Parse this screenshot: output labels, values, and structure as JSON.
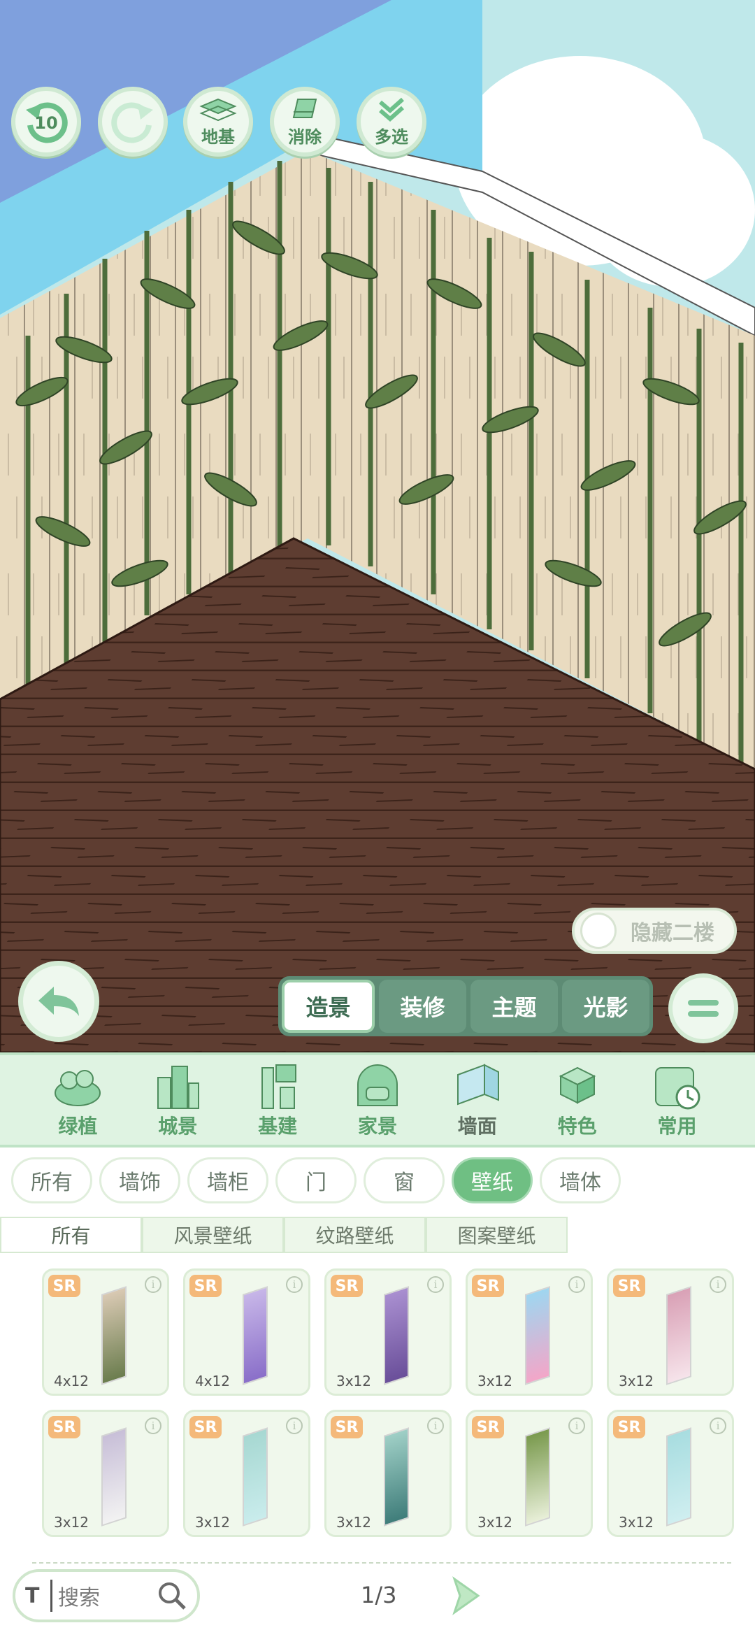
{
  "toolbar": {
    "undo_count": "10",
    "tools": [
      {
        "icon": "undo-icon",
        "label": "10"
      },
      {
        "icon": "redo-icon",
        "label": ""
      },
      {
        "icon": "foundation-icon",
        "label": "地基"
      },
      {
        "icon": "eraser-icon",
        "label": "消除"
      },
      {
        "icon": "multiselect-icon",
        "label": "多选"
      }
    ]
  },
  "hide_second_floor": {
    "label": "隐藏二楼",
    "on": false
  },
  "modes": [
    "造景",
    "装修",
    "主题",
    "光影"
  ],
  "active_mode": "造景",
  "categories": [
    {
      "label": "绿植",
      "icon": "plant-icon"
    },
    {
      "label": "城景",
      "icon": "city-icon"
    },
    {
      "label": "基建",
      "icon": "construction-icon"
    },
    {
      "label": "家景",
      "icon": "home-icon"
    },
    {
      "label": "墙面",
      "icon": "wall-icon"
    },
    {
      "label": "特色",
      "icon": "special-icon"
    },
    {
      "label": "常用",
      "icon": "calendar-icon"
    }
  ],
  "active_category": "墙面",
  "subtabs": [
    "所有",
    "墙饰",
    "墙柜",
    "门",
    "窗",
    "壁纸",
    "墙体"
  ],
  "active_subtab": "壁纸",
  "wallpaper_tabs": [
    "所有",
    "风景壁纸",
    "纹路壁纸",
    "图案壁纸"
  ],
  "active_wallpaper_tab": "所有",
  "items": [
    {
      "rarity": "SR",
      "size": "4x12",
      "color": "#6b7d4e",
      "color2": "#d9c9b3"
    },
    {
      "rarity": "SR",
      "size": "4x12",
      "color": "#8a6fc9",
      "color2": "#c7b6e8"
    },
    {
      "rarity": "SR",
      "size": "3x12",
      "color": "#6a4f9a",
      "color2": "#a98fd0"
    },
    {
      "rarity": "SR",
      "size": "3x12",
      "color": "#f3a6c8",
      "color2": "#9fd6f0"
    },
    {
      "rarity": "SR",
      "size": "3x12",
      "color": "#f6e3ea",
      "color2": "#d9a1b6"
    },
    {
      "rarity": "SR",
      "size": "3x12",
      "color": "#f2f2f2",
      "color2": "#c8bfd8"
    },
    {
      "rarity": "SR",
      "size": "3x12",
      "color": "#c9ecec",
      "color2": "#a7d8d2"
    },
    {
      "rarity": "SR",
      "size": "3x12",
      "color": "#3f7d7a",
      "color2": "#9fcfc6"
    },
    {
      "rarity": "SR",
      "size": "3x12",
      "color": "#e8efd8",
      "color2": "#7a9a4e"
    },
    {
      "rarity": "SR",
      "size": "3x12",
      "color": "#cfeef0",
      "color2": "#a8dde0"
    }
  ],
  "search": {
    "placeholder": "搜索"
  },
  "pagination": "1/3",
  "colors": {
    "accent": "#6fbf83",
    "floor": "#5c3a2e",
    "wall": "#e8d9bd",
    "bamboo": "#4c6b3a",
    "sky": "#86c8e6"
  }
}
